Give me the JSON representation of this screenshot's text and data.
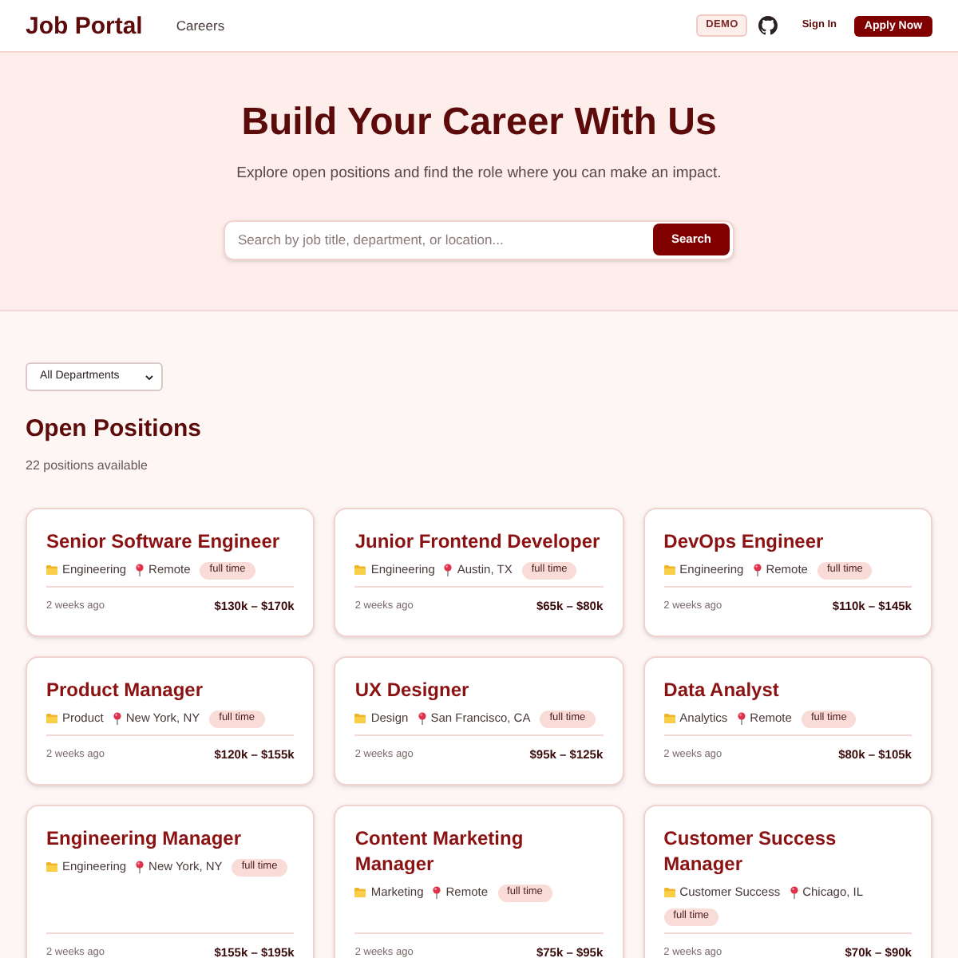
{
  "header": {
    "logo": "Job Portal",
    "nav": [
      {
        "label": "Careers"
      }
    ],
    "badge": "DEMO",
    "sign_in": "Sign In",
    "apply_button": "Apply Now"
  },
  "hero": {
    "title": "Build Your Career With Us",
    "subtitle": "Explore open positions and find the role where you can make an impact.",
    "search": {
      "placeholder": "Search by job title, department, or location...",
      "button": "Search"
    }
  },
  "filter": {
    "value": "All Departments"
  },
  "section": {
    "title": "Open Positions",
    "count": "22 positions available"
  },
  "jobs": [
    {
      "title": "Senior Software Engineer",
      "department": "Engineering",
      "location": "Remote",
      "type": "full time",
      "posted": "2 weeks ago",
      "salary": "$130k – $170k"
    },
    {
      "title": "Junior Frontend Developer",
      "department": "Engineering",
      "location": "Austin, TX",
      "type": "full time",
      "posted": "2 weeks ago",
      "salary": "$65k – $80k"
    },
    {
      "title": "DevOps Engineer",
      "department": "Engineering",
      "location": "Remote",
      "type": "full time",
      "posted": "2 weeks ago",
      "salary": "$110k – $145k"
    },
    {
      "title": "Product Manager",
      "department": "Product",
      "location": "New York, NY",
      "type": "full time",
      "posted": "2 weeks ago",
      "salary": "$120k – $155k"
    },
    {
      "title": "UX Designer",
      "department": "Design",
      "location": "San Francisco, CA",
      "type": "full time",
      "posted": "2 weeks ago",
      "salary": "$95k – $125k"
    },
    {
      "title": "Data Analyst",
      "department": "Analytics",
      "location": "Remote",
      "type": "full time",
      "posted": "2 weeks ago",
      "salary": "$80k – $105k"
    },
    {
      "title": "Engineering Manager",
      "department": "Engineering",
      "location": "New York, NY",
      "type": "full time",
      "posted": "2 weeks ago",
      "salary": "$155k – $195k"
    },
    {
      "title": "Content Marketing Manager",
      "department": "Marketing",
      "location": "Remote",
      "type": "full time",
      "posted": "2 weeks ago",
      "salary": "$75k – $95k"
    },
    {
      "title": "Customer Success Manager",
      "department": "Customer Success",
      "location": "Chicago, IL",
      "type": "full time",
      "posted": "2 weeks ago",
      "salary": "$70k – $90k"
    }
  ]
}
